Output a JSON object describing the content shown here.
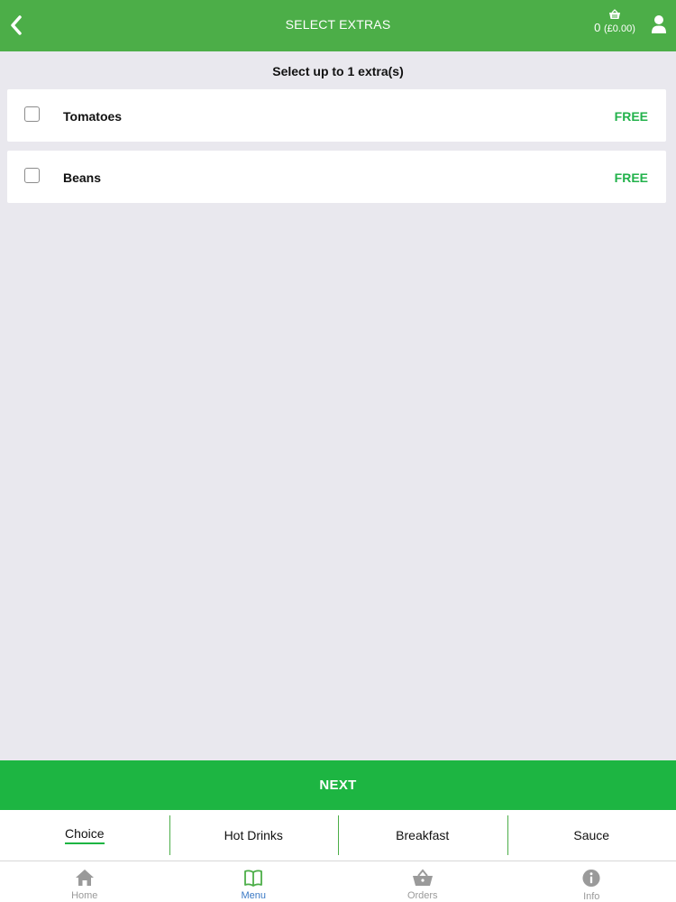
{
  "header": {
    "title": "SELECT EXTRAS",
    "basket": {
      "count": "0",
      "total": "(£0.00)"
    }
  },
  "instruction": "Select up to 1 extra(s)",
  "extras": [
    {
      "name": "Tomatoes",
      "price": "FREE",
      "checked": false
    },
    {
      "name": "Beans",
      "price": "FREE",
      "checked": false
    }
  ],
  "next_label": "NEXT",
  "category_tabs": [
    {
      "label": "Choice",
      "active": true
    },
    {
      "label": "Hot Drinks",
      "active": false
    },
    {
      "label": "Breakfast",
      "active": false
    },
    {
      "label": "Sauce",
      "active": false
    }
  ],
  "bottom_nav": [
    {
      "label": "Home",
      "icon": "home-icon",
      "active": false
    },
    {
      "label": "Menu",
      "icon": "menu-book-icon",
      "active": true
    },
    {
      "label": "Orders",
      "icon": "basket-icon",
      "active": false
    },
    {
      "label": "Info",
      "icon": "info-icon",
      "active": false
    }
  ],
  "colors": {
    "header_green": "#4cae48",
    "accent_green": "#1db542",
    "price_green": "#22b24b",
    "active_nav_blue": "#3a79c5",
    "background": "#e9e8ee"
  }
}
